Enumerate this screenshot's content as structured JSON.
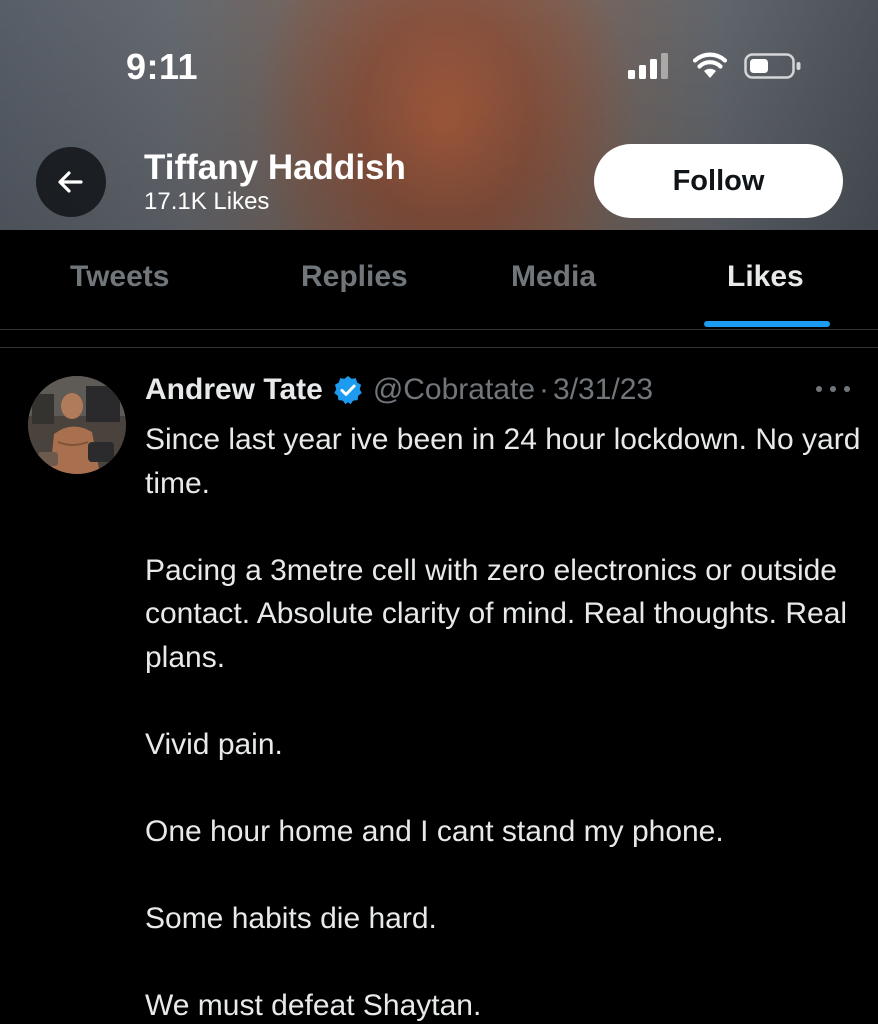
{
  "status_bar": {
    "time": "9:11"
  },
  "header": {
    "back_icon": "arrow-left-icon",
    "name": "Tiffany Haddish",
    "subtitle": "17.1K Likes",
    "follow_label": "Follow"
  },
  "tabs": [
    {
      "label": "Tweets",
      "active": false
    },
    {
      "label": "Replies",
      "active": false
    },
    {
      "label": "Media",
      "active": false
    },
    {
      "label": "Likes",
      "active": true
    }
  ],
  "tweet": {
    "author": "Andrew Tate",
    "handle": "@Cobratate",
    "separator": "·",
    "date": "3/31/23",
    "verified_icon": "verified-badge-icon",
    "more_icon": "more-options-icon",
    "paragraphs": [
      "Since last year ive been in 24 hour lockdown. No yard time.",
      "Pacing a 3metre cell with zero electronics or outside contact. Absolute clarity of mind. Real thoughts. Real plans.",
      "Vivid pain.",
      "One hour home and I cant stand my phone.",
      "Some habits die hard.",
      "We must defeat Shaytan."
    ]
  },
  "colors": {
    "accent": "#1d9bf0",
    "background": "#000000",
    "text_primary": "#e7e9ea",
    "text_secondary": "#71767b",
    "follow_button_bg": "#ffffff"
  }
}
